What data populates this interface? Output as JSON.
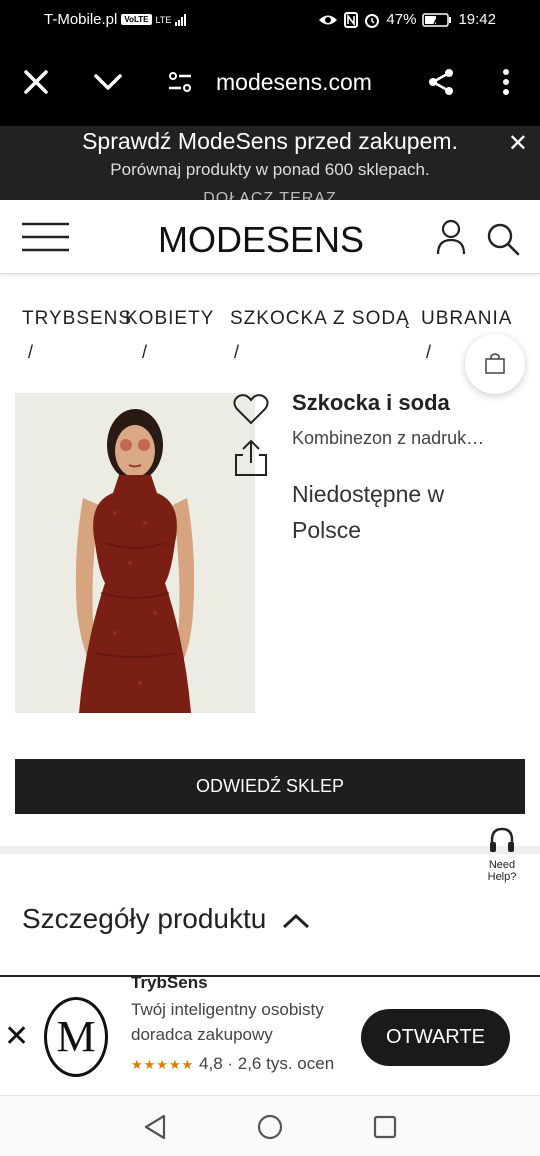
{
  "status": {
    "carrier": "T-Mobile.pl",
    "volte": "VoLTE",
    "network": "LTE",
    "battery": "47%",
    "time": "19:42"
  },
  "browser": {
    "url": "modesens.com",
    "icons": [
      "close-icon",
      "chevron-down-icon",
      "site-settings-icon",
      "share-icon",
      "more-icon"
    ]
  },
  "banner": {
    "title": "Sprawdź ModeSens przed zakupem.",
    "subtitle": "Porównaj produkty w ponad 600 sklepach.",
    "cta": "DOŁĄCZ TERAZ"
  },
  "header": {
    "logo": "MODESENS"
  },
  "breadcrumbs": [
    {
      "label": "TRYBSENS"
    },
    {
      "label": "KOBIETY"
    },
    {
      "label": "SZKOCKA Z SODĄ"
    },
    {
      "label": "UBRANIA"
    }
  ],
  "breadcrumb_separator": "/",
  "product": {
    "brand": "Szkocka i soda",
    "name": "Kombinezon z nadruk…",
    "availability": "Niedostępne w Polsce",
    "visit_button": "ODWIEDŹ SKLEP"
  },
  "help": {
    "line1": "Need",
    "line2": "Help?"
  },
  "details": {
    "title": "Szczegóły produktu"
  },
  "app_promo": {
    "logo_letter": "M",
    "name": "TrybSens",
    "description": "Twój inteligentny osobisty doradca zakupowy",
    "stars": "★★★★★",
    "rating_text": "4,8 · 2,6 tys. ocen",
    "open_button": "OTWARTE"
  },
  "colors": {
    "banner_bg": "#222222",
    "button_dark": "#1e1e1e",
    "star": "#e07b00"
  }
}
